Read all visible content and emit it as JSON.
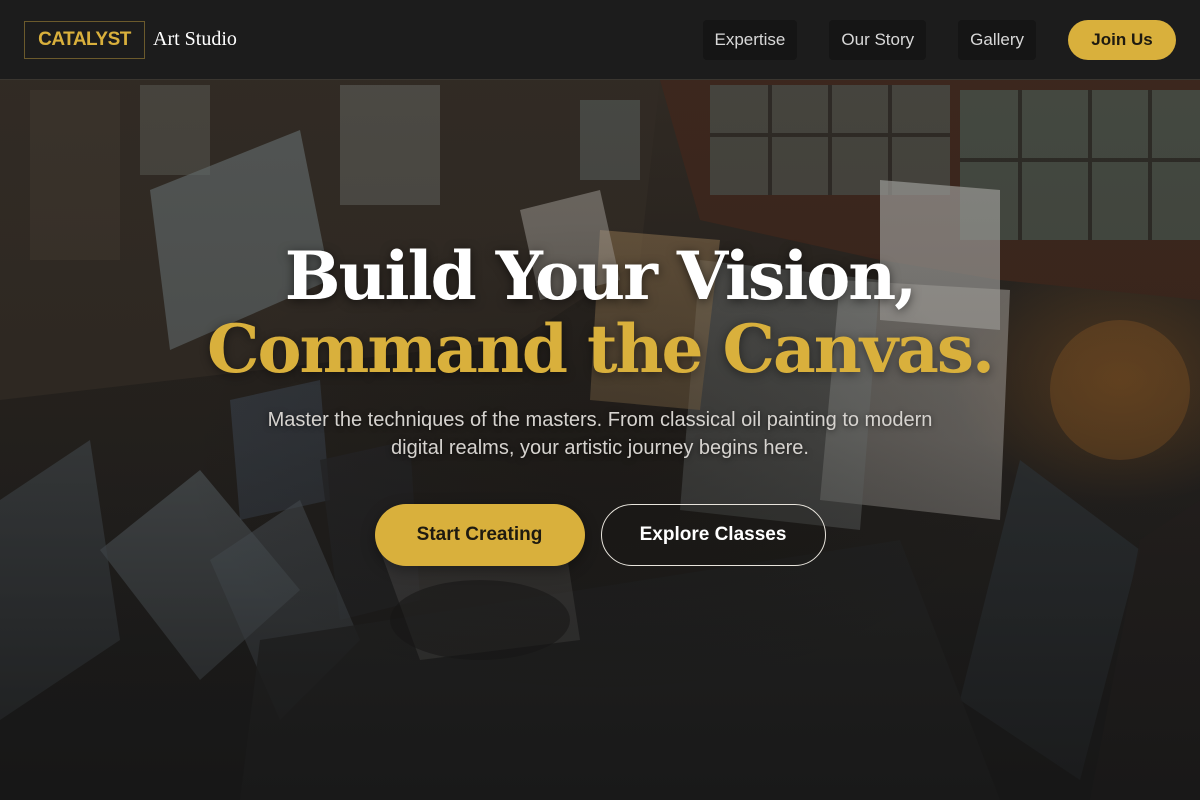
{
  "brand": {
    "logo_text": "CATALYST",
    "logo_subtext": "Art Studio",
    "accent_color": "#d9b03c"
  },
  "nav": {
    "links": [
      {
        "label": "Expertise"
      },
      {
        "label": "Our Story"
      },
      {
        "label": "Gallery"
      }
    ],
    "cta_label": "Join Us"
  },
  "hero": {
    "headline_line1": "Build Your Vision,",
    "headline_line2": "Command the Canvas.",
    "subtitle": "Master the techniques of the masters. From classical oil painting to modern digital realms, your artistic journey begins here.",
    "primary_cta": "Start Creating",
    "secondary_cta": "Explore Classes",
    "background_image": "art-studio-photo"
  }
}
